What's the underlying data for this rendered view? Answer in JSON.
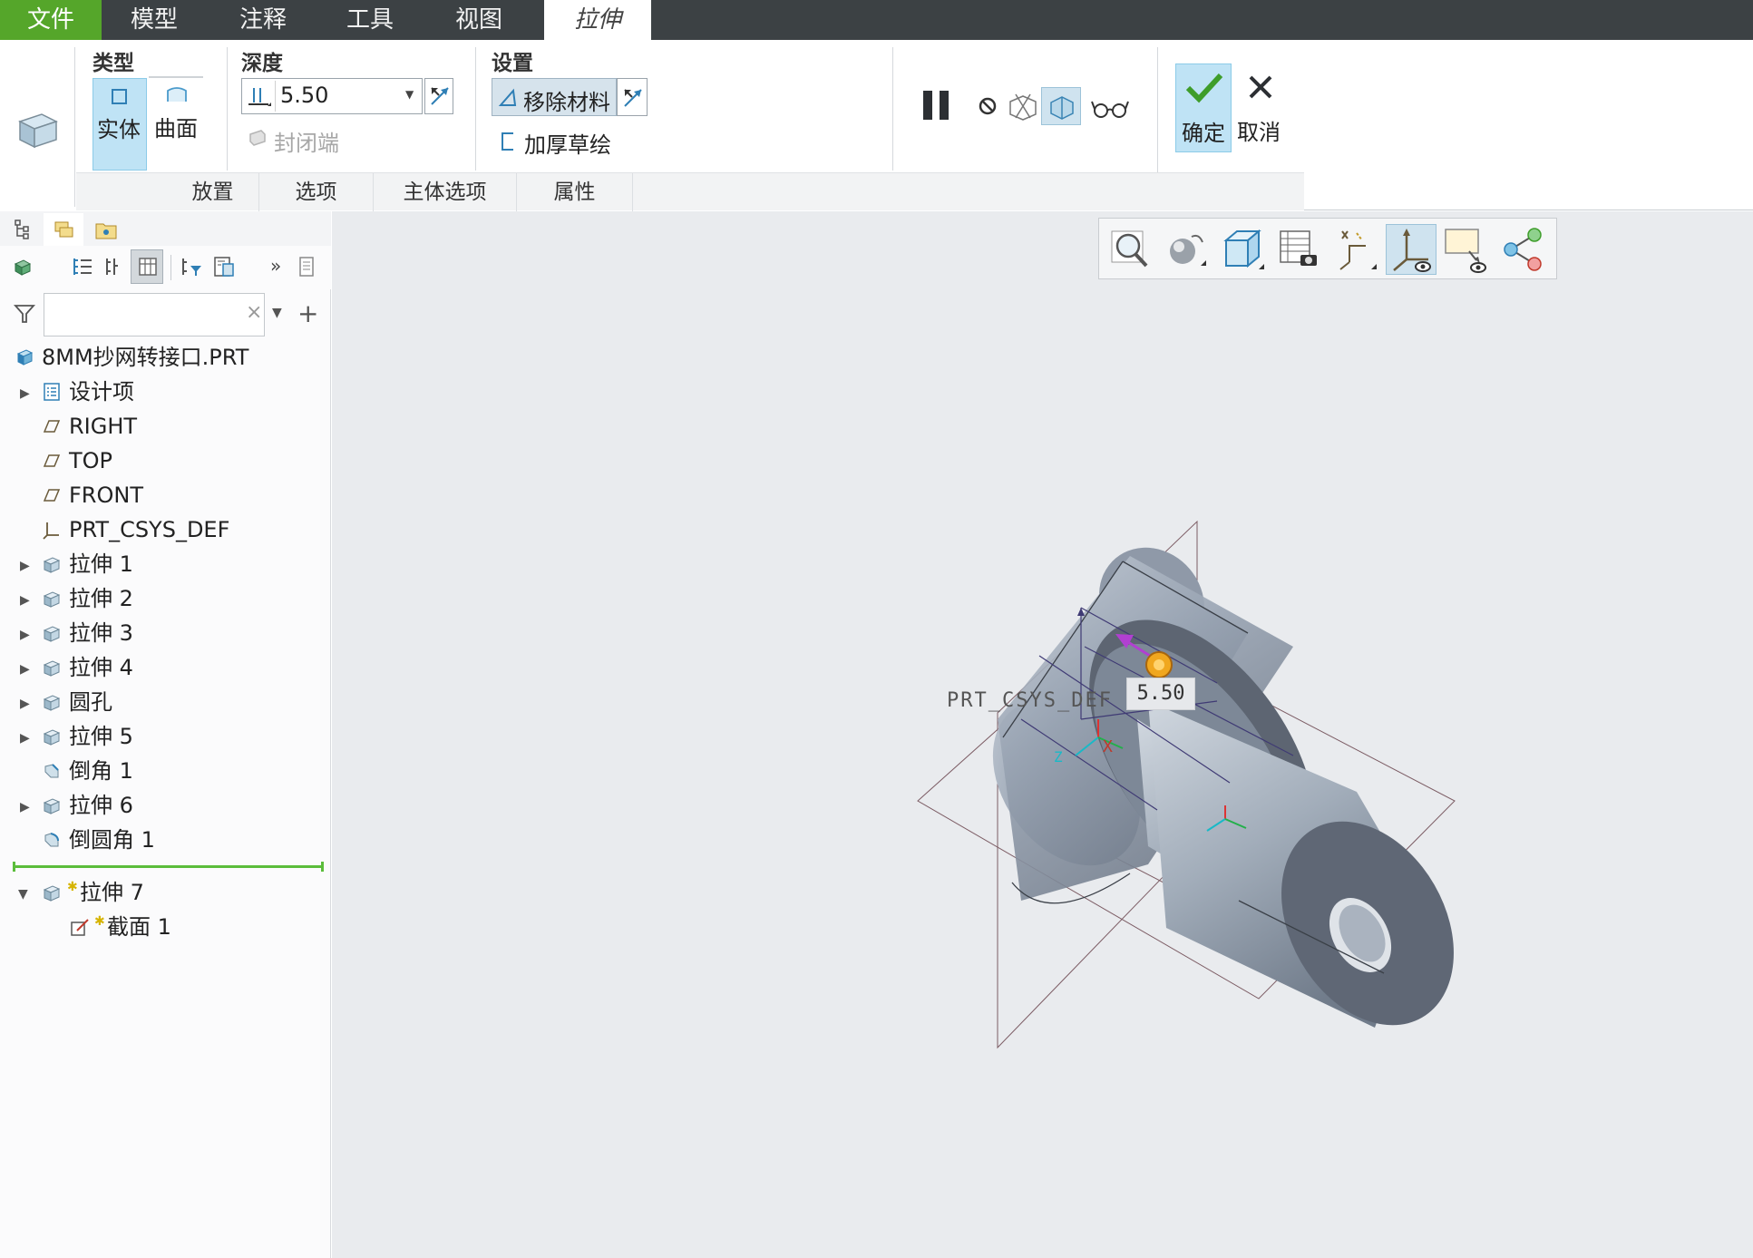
{
  "menu": {
    "file": "文件",
    "model": "模型",
    "annotate": "注释",
    "tools": "工具",
    "view": "视图",
    "extrude": "拉伸"
  },
  "ribbon": {
    "type_title": "类型",
    "solid_label": "实体",
    "surface_label": "曲面",
    "depth_title": "深度",
    "depth_value": "5.50",
    "cap_ends_label": "封闭端",
    "settings_title": "设置",
    "remove_material_label": "移除材料",
    "thicken_sketch_label": "加厚草绘",
    "ok_label": "确定",
    "cancel_label": "取消",
    "bottom_tabs": [
      "放置",
      "选项",
      "主体选项",
      "属性"
    ]
  },
  "tree": {
    "search_placeholder": "",
    "root": "8MM抄网转接口.PRT",
    "items": [
      {
        "label": "设计项",
        "icon": "design-items-icon",
        "expandable": true
      },
      {
        "label": "RIGHT",
        "icon": "datum-plane-icon",
        "expandable": false
      },
      {
        "label": "TOP",
        "icon": "datum-plane-icon",
        "expandable": false
      },
      {
        "label": "FRONT",
        "icon": "datum-plane-icon",
        "expandable": false
      },
      {
        "label": "PRT_CSYS_DEF",
        "icon": "csys-icon",
        "expandable": false
      },
      {
        "label": "拉伸 1",
        "icon": "extrude-icon",
        "expandable": true
      },
      {
        "label": "拉伸 2",
        "icon": "extrude-icon",
        "expandable": true
      },
      {
        "label": "拉伸 3",
        "icon": "extrude-icon",
        "expandable": true
      },
      {
        "label": "拉伸 4",
        "icon": "extrude-icon",
        "expandable": true
      },
      {
        "label": "圆孔",
        "icon": "hole-icon",
        "expandable": true
      },
      {
        "label": "拉伸 5",
        "icon": "extrude-icon",
        "expandable": true
      },
      {
        "label": "倒角 1",
        "icon": "chamfer-icon",
        "expandable": false
      },
      {
        "label": "拉伸 6",
        "icon": "extrude-icon",
        "expandable": true
      },
      {
        "label": "倒圆角 1",
        "icon": "round-icon",
        "expandable": false
      }
    ],
    "active_feature": "拉伸 7",
    "active_section": "截面 1"
  },
  "viewport": {
    "csys_label": "PRT_CSYS_DEF",
    "dimension_value": "5.50",
    "axis_x": "X",
    "axis_z": "Z"
  },
  "colors": {
    "menubar": "#3c4144",
    "file_tab": "#55a62a",
    "selection": "#bfe3f5",
    "viewport_bg": "#e9ebee",
    "model_surface": "#8e98a6",
    "insert_line": "#5bbd3b"
  }
}
